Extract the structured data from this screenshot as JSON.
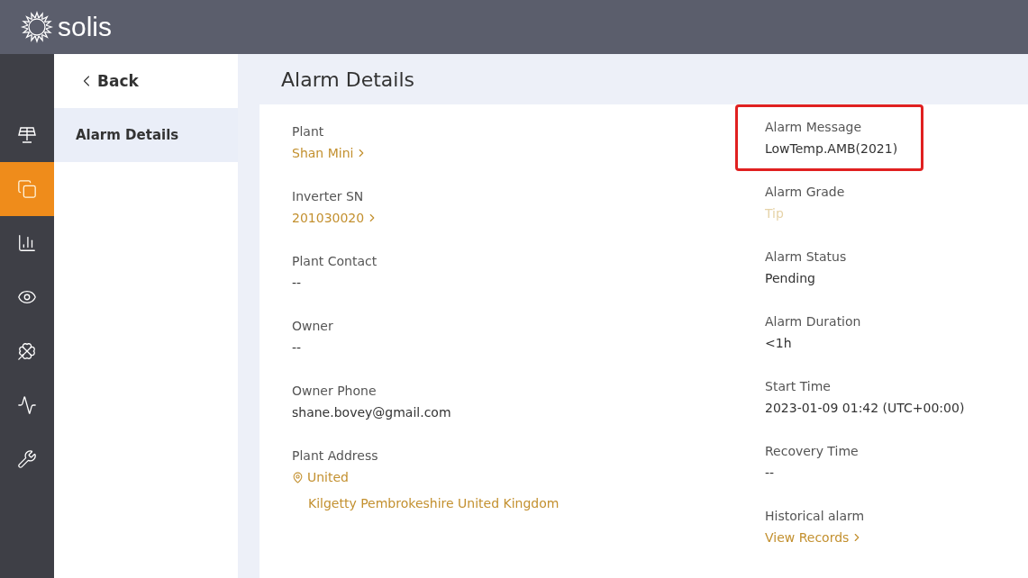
{
  "header": {
    "logo_text": "solis"
  },
  "rail": [
    {
      "selected": false
    },
    {
      "selected": true
    },
    {
      "selected": false
    },
    {
      "selected": false
    },
    {
      "selected": false
    },
    {
      "selected": false
    },
    {
      "selected": false
    }
  ],
  "sidebar": {
    "back": "Back",
    "items": [
      {
        "label": "Alarm Details",
        "selected": true
      }
    ]
  },
  "page_title": "Alarm Details",
  "left_fields": [
    {
      "label": "Plant",
      "value": "Shan    Mini",
      "kind": "link"
    },
    {
      "label": "Inverter SN",
      "value": "201030020",
      "kind": "link"
    },
    {
      "label": "Plant Contact",
      "value": "--",
      "kind": "text"
    },
    {
      "label": "Owner",
      "value": "--",
      "kind": "text"
    },
    {
      "label": "Owner Phone",
      "value": "shane.bovey@gmail.com",
      "kind": "text"
    },
    {
      "label": "Plant Address",
      "value": "United",
      "extra": "Kilgetty Pembrokeshire United Kingdom",
      "kind": "address"
    }
  ],
  "right_fields": [
    {
      "label": "Alarm Message",
      "value": "LowTemp.AMB(2021)",
      "kind": "text",
      "highlighted": true
    },
    {
      "label": "Alarm Grade",
      "value": "Tip",
      "kind": "grade",
      "highlighted": false
    },
    {
      "label": "Alarm Status",
      "value": "Pending",
      "kind": "text",
      "highlighted": false
    },
    {
      "label": "Alarm Duration",
      "value": "<1h",
      "kind": "text",
      "highlighted": false
    },
    {
      "label": "Start Time",
      "value": "2023-01-09 01:42 (UTC+00:00)",
      "kind": "text",
      "highlighted": false
    },
    {
      "label": "Recovery Time",
      "value": "--",
      "kind": "text",
      "highlighted": false
    },
    {
      "label": "Historical alarm",
      "value": "View Records",
      "kind": "link",
      "highlighted": false
    }
  ]
}
